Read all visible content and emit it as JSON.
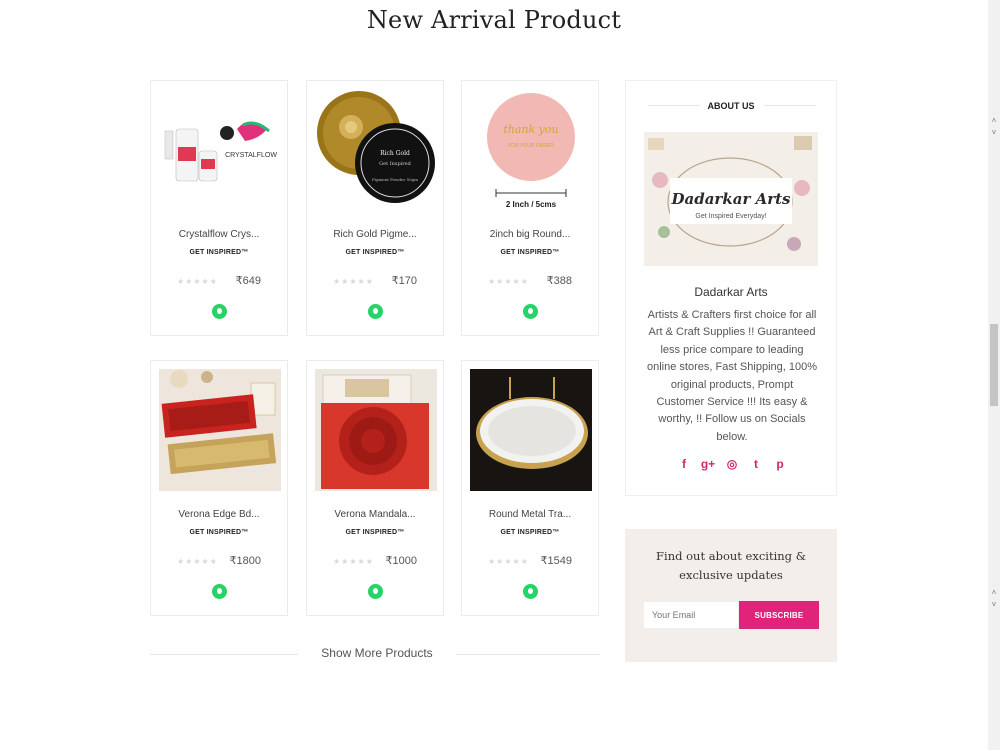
{
  "section_title": "New Arrival Product",
  "products": [
    {
      "name": "Crystalflow Crys...",
      "brand": "GET INSPIRED™",
      "price": "₹649"
    },
    {
      "name": "Rich Gold Pigme...",
      "brand": "GET INSPIRED™",
      "price": "₹170"
    },
    {
      "name": "2inch big Round...",
      "brand": "GET INSPIRED™",
      "price": "₹388"
    },
    {
      "name": "Verona Edge Bd...",
      "brand": "GET INSPIRED™",
      "price": "₹1800"
    },
    {
      "name": "Verona Mandala...",
      "brand": "GET INSPIRED™",
      "price": "₹1000"
    },
    {
      "name": "Round Metal Tra...",
      "brand": "GET INSPIRED™",
      "price": "₹1549"
    }
  ],
  "product_images": {
    "p1_text": "CRYSTALFLOW",
    "p2_text_1": "Rich Gold",
    "p2_text_2": "Get Inspired",
    "p2_text_3": "Pigment Powder 50gm",
    "p3_text_1": "thank you",
    "p3_text_2": "FOR YOUR ORDER",
    "p3_size": "2 Inch / 5cms"
  },
  "show_more": "Show More Products",
  "about": {
    "heading": "ABOUT US",
    "banner_title": "Dadarkar Arts",
    "banner_subtitle": "Get Inspired Everyday!",
    "brand": "Dadarkar Arts",
    "description": "Artists & Crafters first choice for all Art & Craft Supplies !! Guaranteed less price compare to leading online stores, Fast Shipping, 100% original products, Prompt Customer Service !!! Its easy & worthy, !! Follow us on Socials below."
  },
  "social_icons": [
    "facebook-icon",
    "google-plus-icon",
    "instagram-icon",
    "twitter-icon",
    "pinterest-icon"
  ],
  "social_glyphs": [
    "f",
    "g+",
    "◎",
    "t",
    "p"
  ],
  "newsletter": {
    "title": "Find out about exciting & exclusive updates",
    "placeholder": "Your Email",
    "button": "SUBSCRIBE"
  },
  "colors": {
    "accent": "#e0247b",
    "whatsapp": "#25d366"
  }
}
